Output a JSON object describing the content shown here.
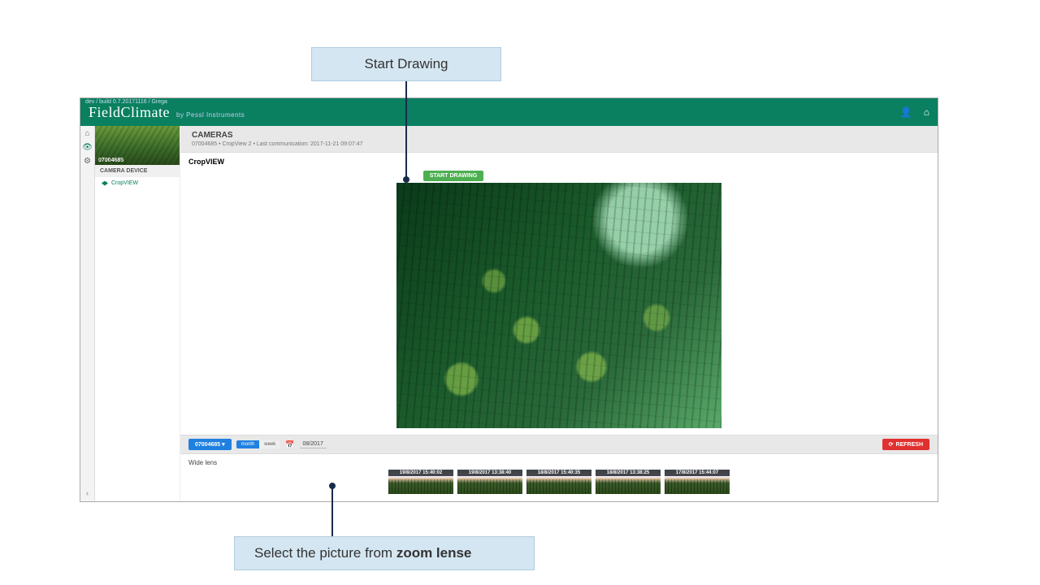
{
  "callouts": {
    "top": "Start Drawing",
    "bottom_prefix": "Select the picture from ",
    "bottom_bold": "zoom lense"
  },
  "topbar": {
    "build": "dev / build 0.7.20171116 / Grega",
    "brand_main": "FieldClimate",
    "brand_sub": "by Pessl Instruments"
  },
  "sidebar": {
    "photo_label": "07004685",
    "section": "CAMERA DEVICE",
    "item": "CropVIEW"
  },
  "page": {
    "title": "CAMERAS",
    "subtitle": "07004685 • CropView 2 • Last communication: 2017-11-21 09:07:47",
    "panel_title": "CropVIEW"
  },
  "buttons": {
    "start_drawing": "START DRAWING",
    "refresh": "REFRESH"
  },
  "filter": {
    "station": "07004685 ▾",
    "toggle_on": "month",
    "toggle_off": "week",
    "date": "08/2017"
  },
  "lens": {
    "title": "Wide lens",
    "thumbs": [
      "19/8/2017 15:40:02",
      "19/8/2017 13:38:40",
      "18/8/2017 15:40:35",
      "18/8/2017 13:38:25",
      "17/8/2017 15:44:07"
    ]
  }
}
